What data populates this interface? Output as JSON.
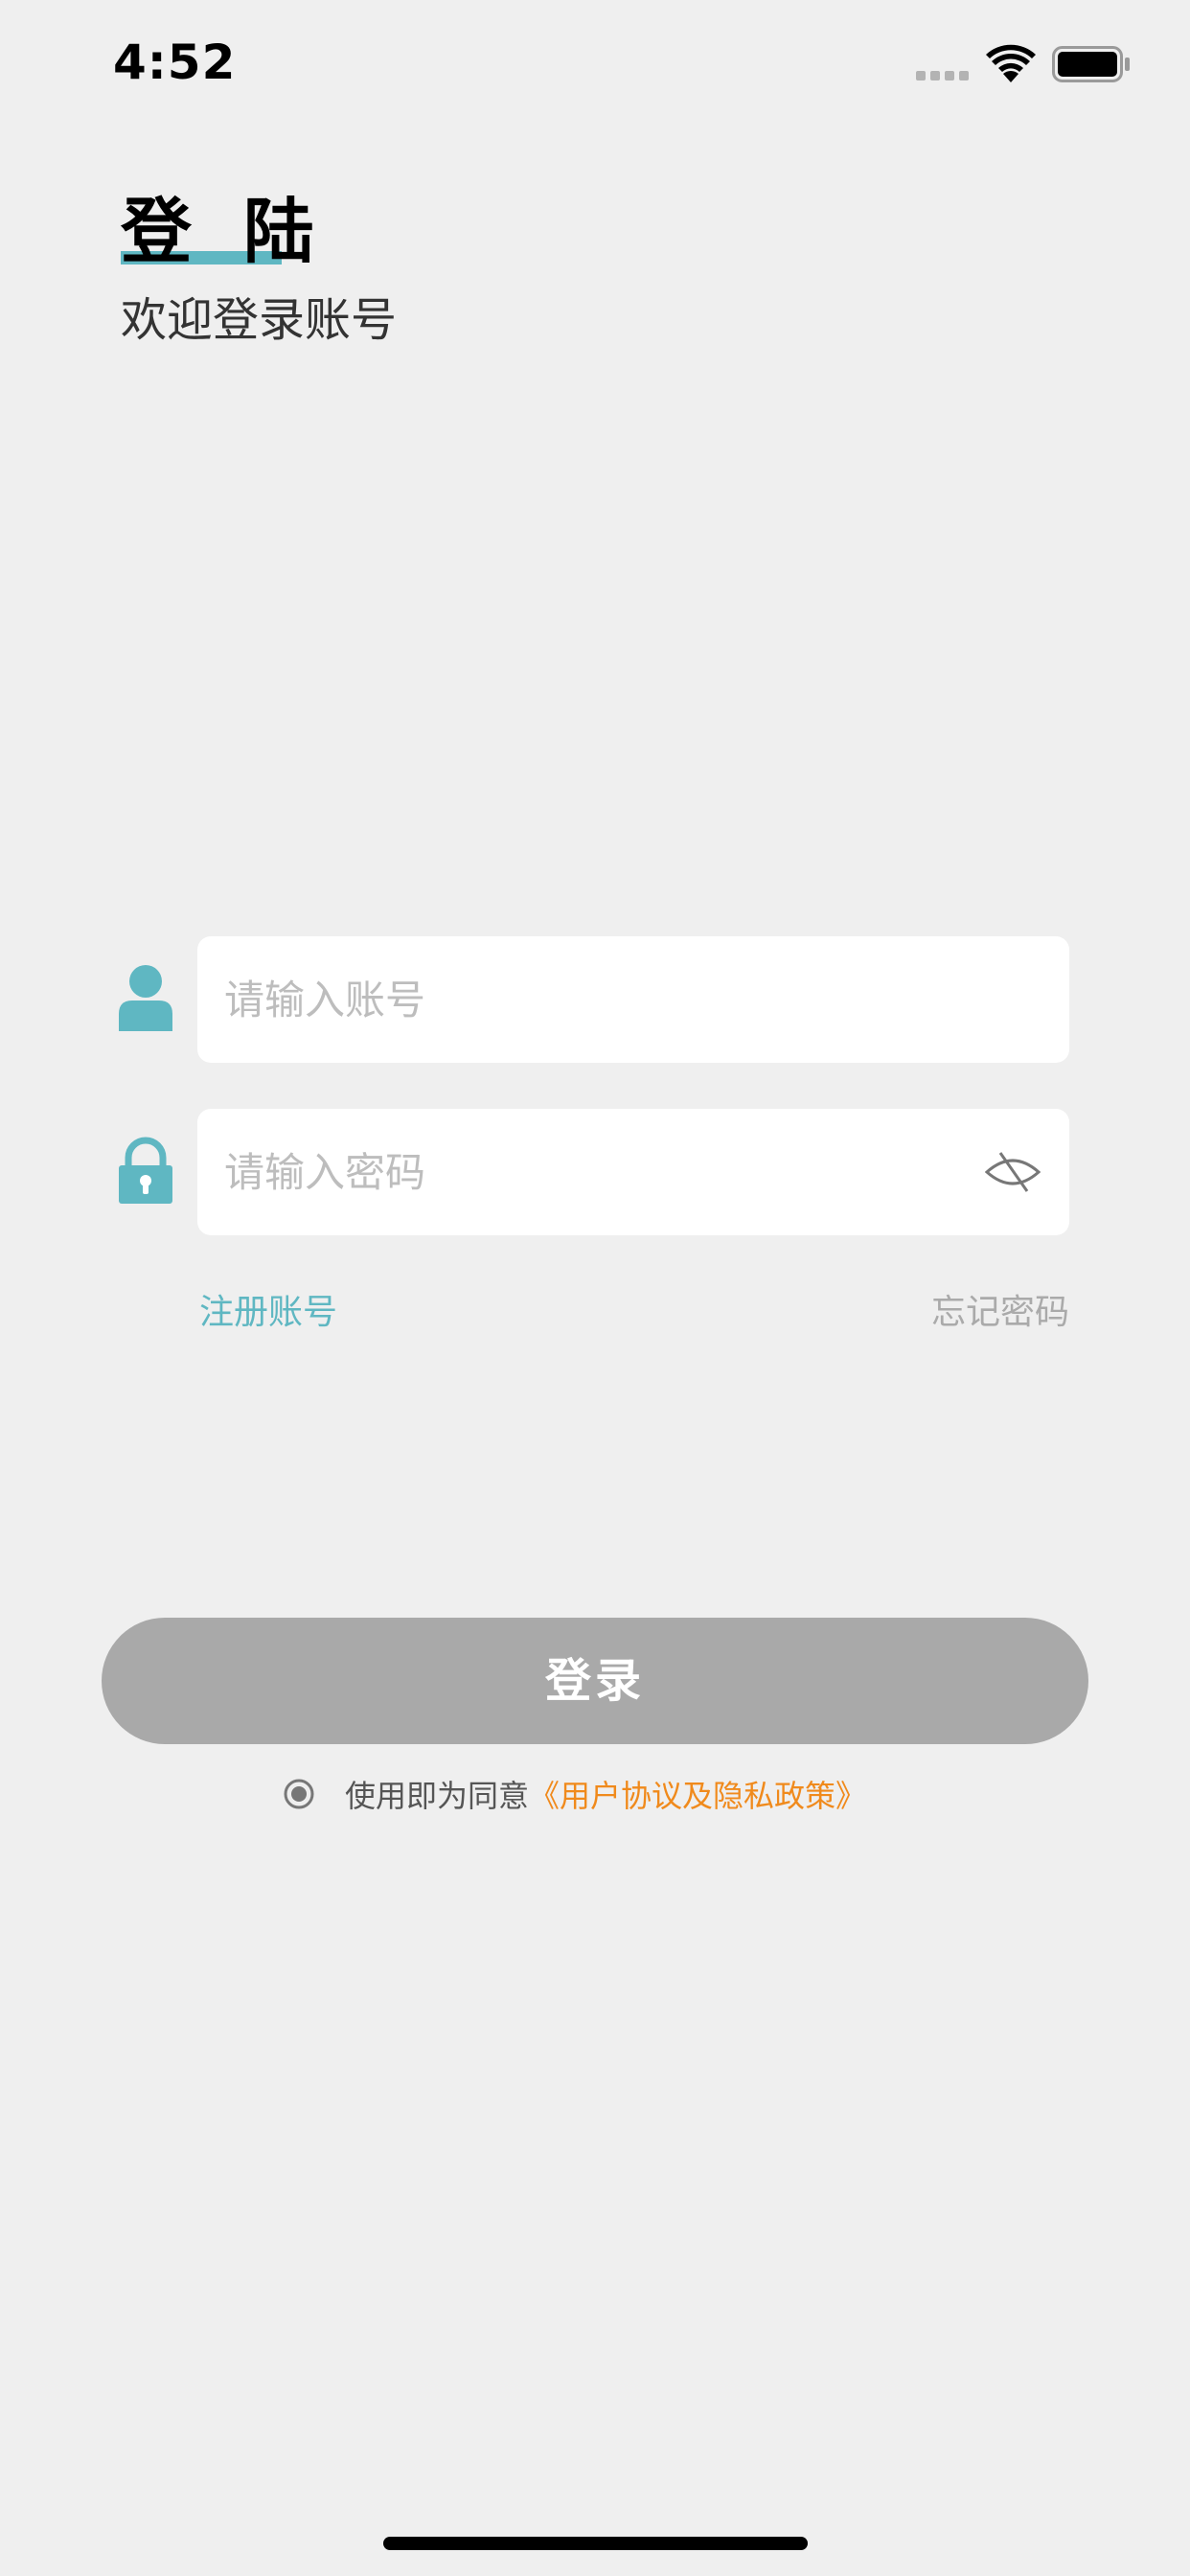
{
  "status_bar": {
    "time": "4:52"
  },
  "header": {
    "title": "登 陆",
    "subtitle": "欢迎登录账号"
  },
  "form": {
    "account": {
      "placeholder": "请输入账号",
      "value": "",
      "icon": "user-icon"
    },
    "password": {
      "placeholder": "请输入密码",
      "value": "",
      "icon": "lock-icon",
      "toggle_icon": "eye-hidden-icon"
    },
    "register_label": "注册账号",
    "forgot_label": "忘记密码"
  },
  "login_button": {
    "label": "登录"
  },
  "agreement": {
    "prefix": "使用即为同意",
    "link_label": "《用户协议及隐私政策》",
    "selected": true
  },
  "colors": {
    "accent": "#5fb7c2",
    "link_orange": "#f08a1c",
    "button_disabled": "#a9a9a9",
    "background": "#efefef"
  }
}
